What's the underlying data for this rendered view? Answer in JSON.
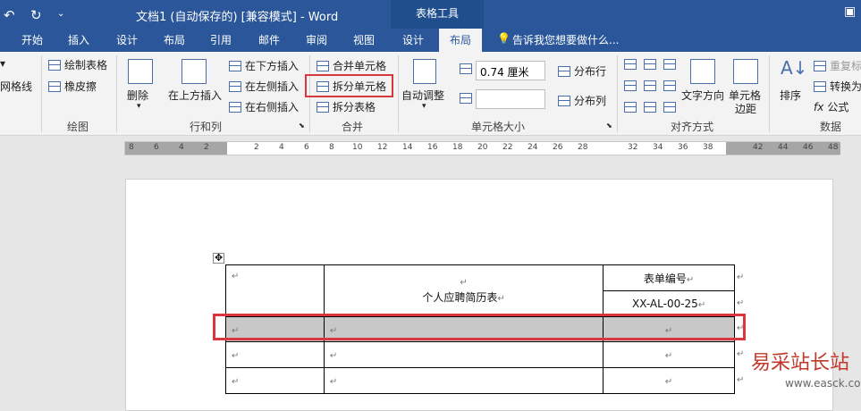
{
  "title_bar": {
    "undo_icon": "undo-icon",
    "redo_icon": "redo-icon",
    "quick_access": "⌄",
    "doc_title": "文档1 (自动保存的) [兼容模式] - Word",
    "context_group": "表格工具"
  },
  "tabs": [
    "开始",
    "插入",
    "设计",
    "布局",
    "引用",
    "邮件",
    "审阅",
    "视图",
    "设计",
    "布局"
  ],
  "active_tab_index": 9,
  "tell_me": "告诉我您想要做什么...",
  "ribbon": {
    "gridlines": "网格线",
    "draw_table": "绘制表格",
    "eraser": "橡皮擦",
    "group_draw": "绘图",
    "delete": "删除",
    "insert_above": "在上方插入",
    "insert_below": "在下方插入",
    "insert_left": "在左侧插入",
    "insert_right": "在右侧插入",
    "group_rows_cols": "行和列",
    "merge_cells": "合并单元格",
    "split_cells": "拆分单元格",
    "split_table": "拆分表格",
    "group_merge": "合并",
    "autofit": "自动调整",
    "height_value": "0.74 厘米",
    "width_value": "",
    "distribute_rows": "分布行",
    "distribute_cols": "分布列",
    "group_cell_size": "单元格大小",
    "text_direction": "文字方向",
    "cell_margins_1": "单元格",
    "cell_margins_2": "边距",
    "group_alignment": "对齐方式",
    "sort": "排序",
    "repeat_header": "重复标",
    "convert": "转换为",
    "formula": "公式",
    "group_data": "数据"
  },
  "ruler_labels": [
    "8",
    "6",
    "4",
    "2",
    "2",
    "4",
    "6",
    "8",
    "10",
    "12",
    "14",
    "16",
    "18",
    "20",
    "22",
    "24",
    "26",
    "28",
    "32",
    "34",
    "36",
    "38",
    "42",
    "44",
    "46",
    "48"
  ],
  "document": {
    "table_title": "个人应聘简历表",
    "form_number_label": "表单编号",
    "form_number_value": "XX-AL-00-25",
    "paragraph_mark": "↵"
  },
  "watermark": {
    "text": "易采站长站",
    "url": "www.easck.com"
  }
}
